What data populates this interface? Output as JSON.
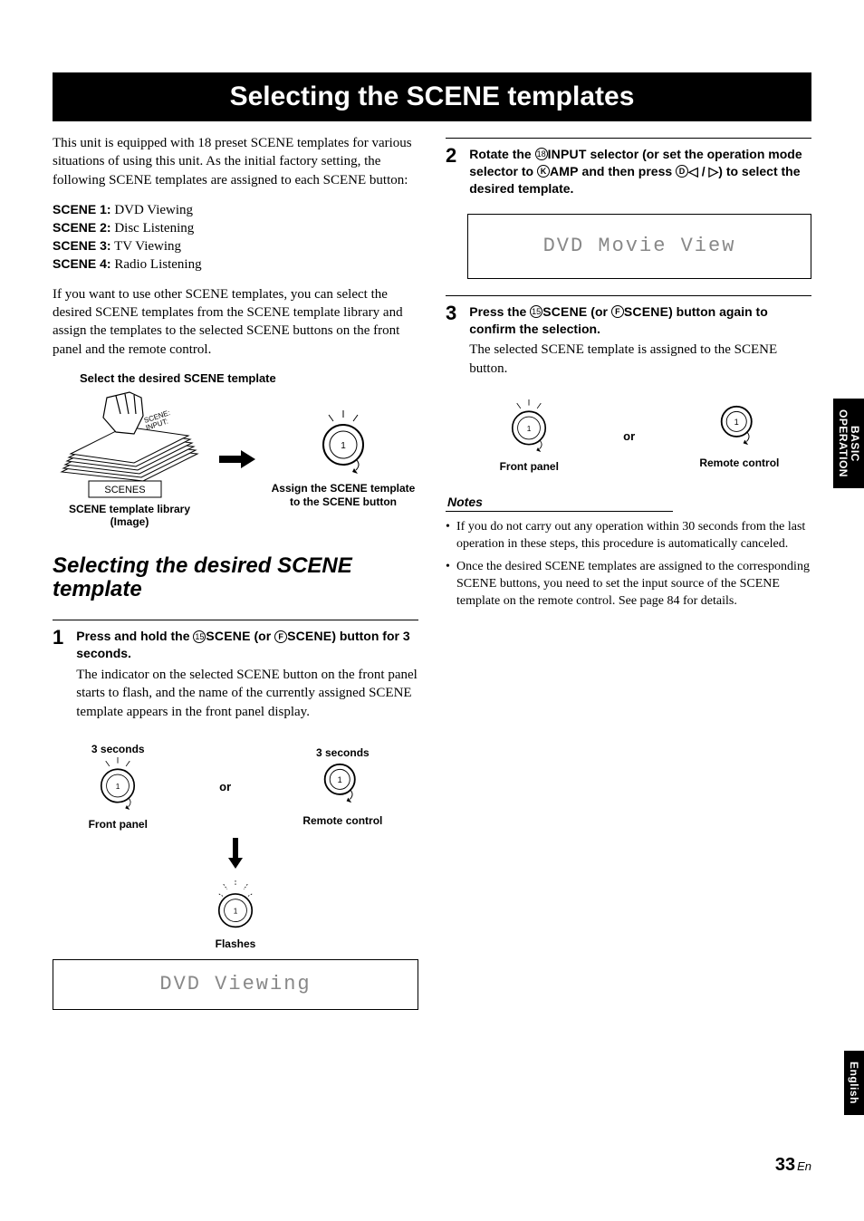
{
  "title_bar": "Selecting the SCENE templates",
  "intro": "This unit is equipped with 18 preset SCENE templates for various situations of using this unit. As the initial factory setting, the following SCENE templates are assigned to each SCENE button:",
  "scenes": [
    {
      "label": "SCENE 1:",
      "value": "DVD Viewing"
    },
    {
      "label": "SCENE 2:",
      "value": "Disc Listening"
    },
    {
      "label": "SCENE 3:",
      "value": "TV Viewing"
    },
    {
      "label": "SCENE 4:",
      "value": "Radio Listening"
    }
  ],
  "intro2": "If you want to use other SCENE templates, you can select the desired SCENE templates from the SCENE template library and assign the templates to the selected SCENE buttons on the front panel and the remote control.",
  "fig": {
    "select_label": "Select the desired SCENE template",
    "library_label_top": "SCENES",
    "hand_label": "SCENE:\nINPUT:",
    "library_caption": "SCENE template library\n(Image)",
    "assign_caption": "Assign the SCENE template to the SCENE button"
  },
  "section_heading": "Selecting the desired SCENE template",
  "step1": {
    "num": "1",
    "heading_pre": "Press and hold the ",
    "circ1": "⑮",
    "btn1": "SCENE",
    "mid": " (or ",
    "circ2": "Ⓕ",
    "btn2": "SCENE",
    "heading_post": ") button for 3 seconds.",
    "body": "The indicator on the selected SCENE button on the front panel starts to flash, and the name of the currently assigned SCENE template appears in the front panel display.",
    "label_3sec": "3 seconds",
    "or": "or",
    "front_panel": "Front panel",
    "remote_control": "Remote control",
    "flashes": "Flashes",
    "display": "DVD Viewing"
  },
  "step2": {
    "num": "2",
    "heading_pre": "Rotate the ",
    "circ1": "⑱",
    "btn1": "INPUT",
    "mid1": " selector (or set the operation mode selector to ",
    "circ2": "Ⓚ",
    "btn2": "AMP",
    "mid2": " and then press ",
    "circ3": "Ⓓ",
    "tri_l": "◁",
    "slash": " / ",
    "tri_r": "▷",
    "heading_post": ") to select the desired template.",
    "display": "DVD Movie View"
  },
  "step3": {
    "num": "3",
    "heading_pre": "Press the ",
    "circ1": "⑮",
    "btn1": "SCENE",
    "mid": " (or ",
    "circ2": "Ⓕ",
    "btn2": "SCENE",
    "heading_post": ") button again to confirm the selection.",
    "body": "The selected SCENE template is assigned to the SCENE button.",
    "or": "or",
    "front_panel": "Front panel",
    "remote_control": "Remote control"
  },
  "notes_label": "Notes",
  "notes": [
    "If you do not carry out any operation within 30 seconds from the last operation in these steps, this procedure is automatically canceled.",
    "Once the desired SCENE templates are assigned to the corresponding SCENE buttons, you need to set the input source of the SCENE template on the remote control. See page 84 for details."
  ],
  "side_tabs": {
    "basic": "BASIC\nOPERATION",
    "english": "English"
  },
  "page": {
    "num": "33",
    "suffix": "En"
  }
}
